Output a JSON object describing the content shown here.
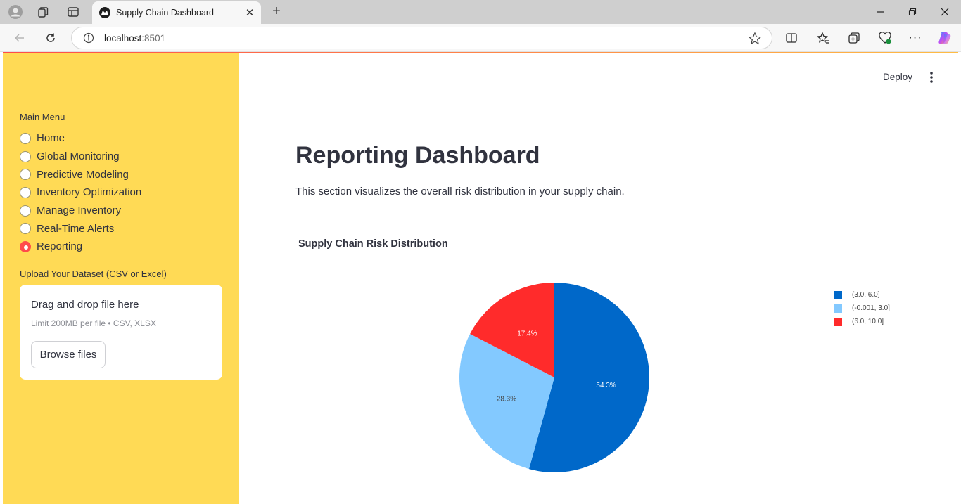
{
  "browser": {
    "tab_title": "Supply Chain Dashboard",
    "url_host": "localhost",
    "url_port": ":8501"
  },
  "sidebar": {
    "menu_title": "Main Menu",
    "items": [
      {
        "label": "Home",
        "selected": false
      },
      {
        "label": "Global Monitoring",
        "selected": false
      },
      {
        "label": "Predictive Modeling",
        "selected": false
      },
      {
        "label": "Inventory Optimization",
        "selected": false
      },
      {
        "label": "Manage Inventory",
        "selected": false
      },
      {
        "label": "Real-Time Alerts",
        "selected": false
      },
      {
        "label": "Reporting",
        "selected": true
      }
    ],
    "upload_label": "Upload Your Dataset (CSV or Excel)",
    "dropzone_title": "Drag and drop file here",
    "dropzone_limit": "Limit 200MB per file • CSV, XLSX",
    "browse_label": "Browse files"
  },
  "header": {
    "deploy_label": "Deploy"
  },
  "main": {
    "title": "Reporting Dashboard",
    "description": "This section visualizes the overall risk distribution in your supply chain."
  },
  "colors": {
    "sidebar_bg": "#ffda55",
    "accent": "#ff4b4b"
  },
  "chart_data": {
    "type": "pie",
    "title": "Supply Chain Risk Distribution",
    "legend_position": "right",
    "slices": [
      {
        "label": "(3.0, 6.0]",
        "value": 54.3,
        "text": "54.3%",
        "color": "#0068c9"
      },
      {
        "label": "(-0.001, 3.0]",
        "value": 28.3,
        "text": "28.3%",
        "color": "#83c9ff"
      },
      {
        "label": "(6.0, 10.0]",
        "value": 17.4,
        "text": "17.4%",
        "color": "#ff2b2b"
      }
    ]
  }
}
